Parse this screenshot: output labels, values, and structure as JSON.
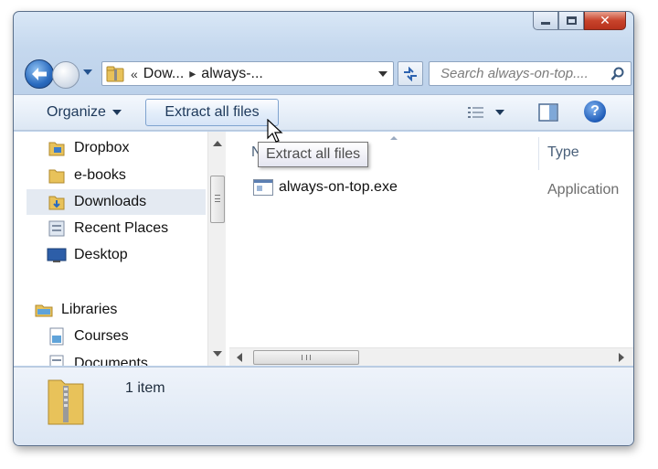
{
  "address": {
    "overflow": "«",
    "crumbs": [
      "Dow...",
      "always-..."
    ]
  },
  "search": {
    "placeholder": "Search always-on-top...."
  },
  "toolbar": {
    "organize_label": "Organize",
    "extract_label": "Extract all files"
  },
  "tooltip": {
    "text": "Extract all files"
  },
  "nav_pane": {
    "items": [
      {
        "label": "Dropbox",
        "icon": "dropbox-folder-icon"
      },
      {
        "label": "e-books",
        "icon": "folder-icon"
      },
      {
        "label": "Downloads",
        "icon": "downloads-folder-icon",
        "selected": true
      },
      {
        "label": "Recent Places",
        "icon": "recent-places-icon"
      },
      {
        "label": "Desktop",
        "icon": "desktop-icon"
      }
    ],
    "libraries_label": "Libraries",
    "library_items": [
      {
        "label": "Courses",
        "icon": "library-doc-icon"
      },
      {
        "label": "Documents",
        "icon": "library-doc-icon"
      }
    ]
  },
  "content": {
    "columns": {
      "name": "Na",
      "type": "Type"
    },
    "files": [
      {
        "name": "always-on-top.exe",
        "type": "Application"
      }
    ]
  },
  "details": {
    "item_count": "1 item"
  },
  "colors": {
    "accent": "#2a6bbf",
    "selection": "#e4eaf2",
    "close_button": "#c8432b",
    "folder": "#e8c25a"
  }
}
